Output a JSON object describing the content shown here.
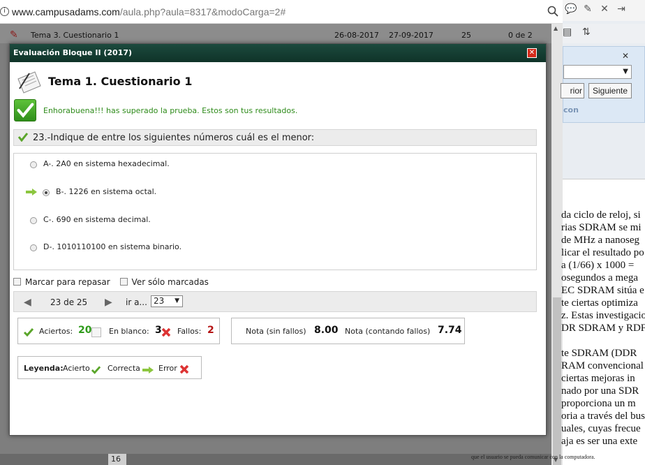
{
  "browser": {
    "url_host": "www.campusadams.com",
    "url_path": "/aula.php?aula=8317&modoCarga=2#"
  },
  "background_row": {
    "title": "Tema 3. Cuestionario 1",
    "date_start": "26-08-2017",
    "date_end": "27-09-2017",
    "count": "25",
    "progress": "0 de 2",
    "bottom_number": "16"
  },
  "right_panel": {
    "find_prev_label": "rior",
    "find_next_label": "Siguiente",
    "find_option_label": "con",
    "doc_lines": [
      "da ciclo de reloj, si",
      "rias SDRAM se mi",
      "de MHz a nanoseg",
      "licar el resultado po",
      "a (1/66) x 1000 =",
      "osegundos a mega",
      "EC SDRAM sitúa e",
      "te ciertas optimiza",
      "z. Estas investigacio",
      "DR SDRAM y RDF",
      "",
      "te SDRAM (DDR",
      "RAM convencional",
      " ciertas mejoras in",
      "nado por una SDR",
      "proporciona un m",
      "oria a través del bus",
      "uales, cuyas frecue",
      "aja es ser una exte"
    ],
    "doc_footer": "que el usuario se pueda comunicar con la computadora."
  },
  "dialog": {
    "title": "Evaluación Bloque II (2017)",
    "quiz_title": "Tema 1. Cuestionario 1",
    "success_message": "Enhorabuena!!! has superado la prueba. Estos son tus resultados.",
    "question": "23.-Indique de entre los siguientes números cuál es el menor:",
    "answers": [
      {
        "label": "A-. 2A0 en sistema hexadecimal.",
        "selected": false,
        "correct": false
      },
      {
        "label": "B-. 1226 en sistema octal.",
        "selected": true,
        "correct": true
      },
      {
        "label": "C-. 690 en sistema decimal.",
        "selected": false,
        "correct": false
      },
      {
        "label": "D-. 1010110100 en sistema binario.",
        "selected": false,
        "correct": false
      }
    ],
    "mark_review_label": "Marcar para repasar",
    "show_marked_label": "Ver sólo marcadas",
    "nav_position": "23 de 25",
    "goto_label": "ir a...",
    "goto_value": "23",
    "stats": {
      "aciertos_label": "Aciertos:",
      "aciertos_value": "20",
      "blanco_label": "En blanco:",
      "blanco_value": "3",
      "fallos_label": "Fallos:",
      "fallos_value": "2",
      "nota_sin_label": "Nota (sin fallos)",
      "nota_sin_value": "8.00",
      "nota_con_label": "Nota (contando fallos)",
      "nota_con_value": "7.74"
    },
    "legend": {
      "title": "Leyenda:",
      "acierto": "Acierto",
      "correcta": "Correcta",
      "error": "Error"
    }
  },
  "colors": {
    "title_bar": "#1c4a3e",
    "success_green": "#2e8b1a",
    "error_red": "#d42a1a"
  }
}
